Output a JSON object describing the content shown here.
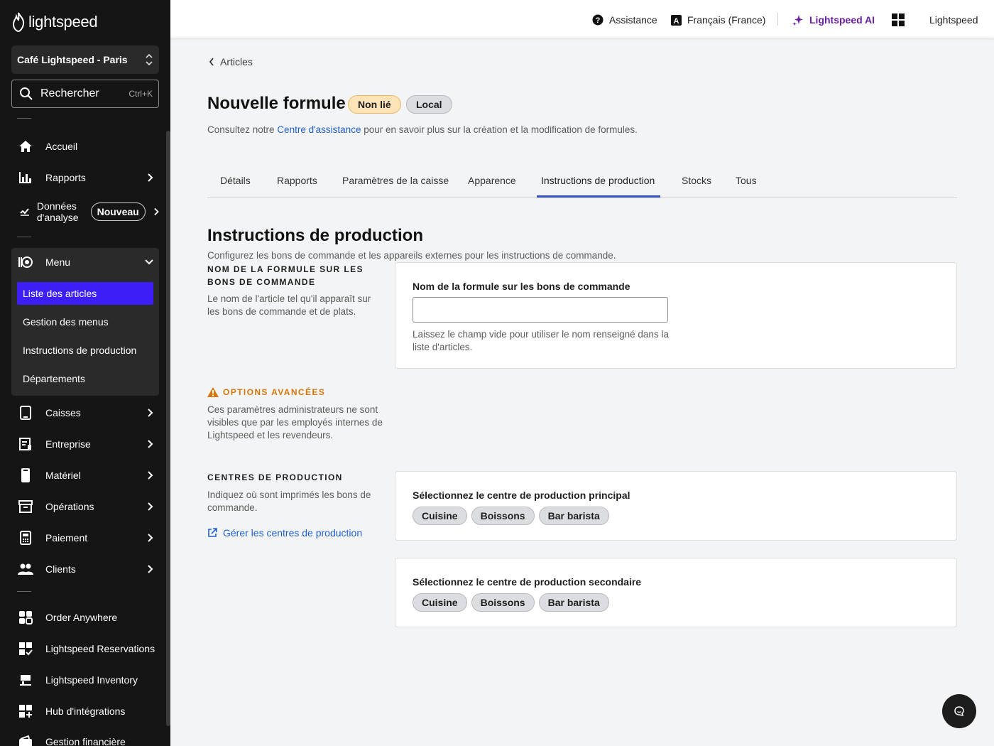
{
  "sidebar": {
    "logo_text": "lightspeed",
    "store_name": "Café Lightspeed - Paris",
    "search": {
      "label": "Rechercher",
      "shortcut": "Ctrl+K"
    },
    "nav": [
      {
        "label": "Accueil",
        "icon": "home-icon"
      },
      {
        "label": "Rapports",
        "icon": "bar-chart-icon"
      },
      {
        "label": "Données d'analyse",
        "icon": "analytics-icon",
        "badge": "Nouveau"
      },
      {
        "label": "Menu",
        "icon": "menu-book-icon"
      },
      {
        "label": "Caisses",
        "icon": "tablet-icon"
      },
      {
        "label": "Entreprise",
        "icon": "building-icon"
      },
      {
        "label": "Matériel",
        "icon": "device-icon"
      },
      {
        "label": "Opérations",
        "icon": "archive-icon"
      },
      {
        "label": "Paiement",
        "icon": "payment-terminal-icon"
      },
      {
        "label": "Clients",
        "icon": "users-icon"
      },
      {
        "label": "Order Anywhere",
        "icon": "order-anywhere-icon"
      },
      {
        "label": "Lightspeed Reservations",
        "icon": "reservations-icon"
      },
      {
        "label": "Lightspeed Inventory",
        "icon": "inventory-icon"
      },
      {
        "label": "Hub d'intégrations",
        "icon": "integrations-icon"
      },
      {
        "label": "Gestion financière",
        "icon": "wallet-icon"
      }
    ],
    "menu_sub": [
      {
        "label": "Liste des articles",
        "active": true
      },
      {
        "label": "Gestion des menus"
      },
      {
        "label": "Instructions de production"
      },
      {
        "label": "Départements"
      }
    ]
  },
  "topbar": {
    "help": "Assistance",
    "language": "Français (France)",
    "ai": "Lightspeed AI",
    "account": "Lightspeed"
  },
  "page": {
    "breadcrumb": "Articles",
    "title": "Nouvelle formule",
    "badges": [
      "Non lié",
      "Local"
    ],
    "subtitle_pre": "Consultez notre ",
    "subtitle_link": "Centre d'assistance",
    "subtitle_post": " pour en savoir plus sur la création et la modification de formules.",
    "tabs": [
      "Détails",
      "Rapports",
      "Paramètres de la caisse",
      "Apparence",
      "Instructions de production",
      "Stocks",
      "Tous"
    ],
    "active_tab": "Instructions de production"
  },
  "section": {
    "title": "Instructions de production",
    "desc": "Configurez les bons de commande et les appareils externes pour les instructions de commande.",
    "ticket_name": {
      "caps": "NOM DE LA FORMULE SUR LES BONS DE COMMANDE",
      "desc": "Le nom de l'article tel qu'il apparaît sur les bons de commande et de plats.",
      "field_label": "Nom de la formule sur les bons de commande",
      "value": "",
      "hint": "Laissez le champ vide pour utiliser le nom renseigné dans la liste d'articles."
    },
    "advanced": {
      "caps": "OPTIONS AVANCÉES",
      "desc": "Ces paramètres administrateurs ne sont visibles que par les employés internes de Lightspeed et les revendeurs.",
      "color": "#d9770f"
    },
    "centers": {
      "caps": "CENTRES DE PRODUCTION",
      "desc": "Indiquez où sont imprimés les bons de commande.",
      "manage_link": "Gérer les centres de production",
      "primary_label": "Sélectionnez le centre de production principal",
      "secondary_label": "Sélectionnez le centre de production secondaire",
      "options": [
        "Cuisine",
        "Boissons",
        "Bar barista"
      ]
    }
  }
}
